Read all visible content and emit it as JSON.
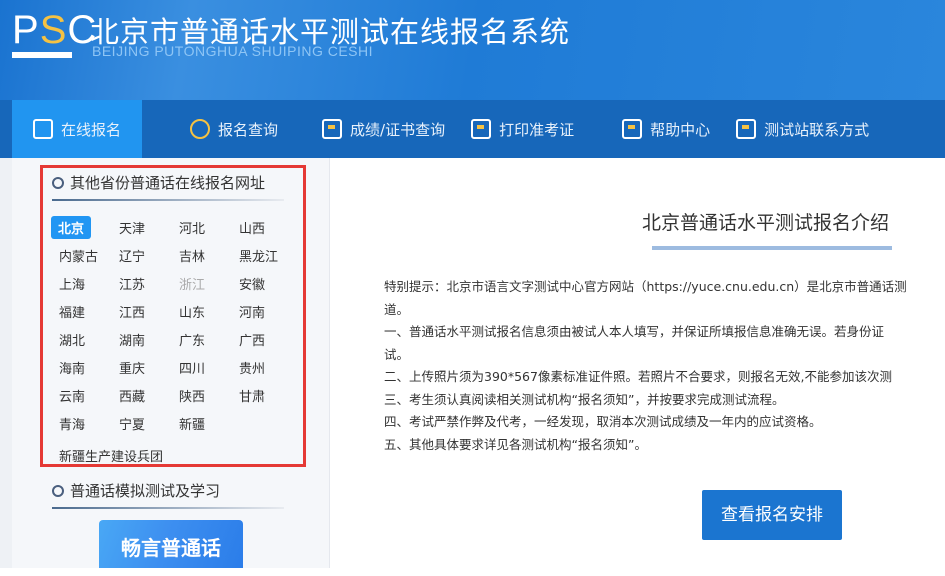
{
  "header": {
    "logo_text": "PSC",
    "title": "北京市普通话水平测试在线报名系统",
    "subtitle": "BEIJING PUTONGHUA SHUIPING CESHI"
  },
  "nav": [
    {
      "label": "在线报名",
      "icon": "edit-icon",
      "active": true
    },
    {
      "label": "报名查询",
      "icon": "search-icon"
    },
    {
      "label": "成绩/证书查询",
      "icon": "document-search-icon"
    },
    {
      "label": "打印准考证",
      "icon": "printer-icon"
    },
    {
      "label": "帮助中心",
      "icon": "help-icon"
    },
    {
      "label": "测试站联系方式",
      "icon": "phone-icon"
    }
  ],
  "sidebar": {
    "section1_title": "其他省份普通话在线报名网址",
    "provinces": [
      "北京",
      "天津",
      "河北",
      "山西",
      "内蒙古",
      "辽宁",
      "吉林",
      "黑龙江",
      "上海",
      "江苏",
      "浙江",
      "安徽",
      "福建",
      "江西",
      "山东",
      "河南",
      "湖北",
      "湖南",
      "广东",
      "广西",
      "海南",
      "重庆",
      "四川",
      "贵州",
      "云南",
      "西藏",
      "陕西",
      "甘肃",
      "青海",
      "宁夏",
      "新疆"
    ],
    "active_province": "北京",
    "disabled_province": "浙江",
    "bingtuan": "新疆生产建设兵团",
    "section2_title": "普通话模拟测试及学习",
    "promo_label": "畅言普通话"
  },
  "main": {
    "title": "北京普通话水平测试报名介绍",
    "notice": [
      "特别提示：北京市语言文字测试中心官方网站（https://yuce.cnu.edu.cn）是北京市普通话测",
      "道。",
      "一、普通话水平测试报名信息须由被试人本人填写，并保证所填报信息准确无误。若身份证",
      "试。",
      "二、上传照片须为390*567像素标准证件照。若照片不合要求，则报名无效,不能参加该次测",
      "三、考生须认真阅读相关测试机构“报名须知”，并按要求完成测试流程。",
      "四、考试严禁作弊及代考，一经发现，取消本次测试成绩及一年内的应试资格。",
      "五、其他具体要求详见各测试机构“报名须知”。"
    ],
    "button_label": "查看报名安排"
  }
}
